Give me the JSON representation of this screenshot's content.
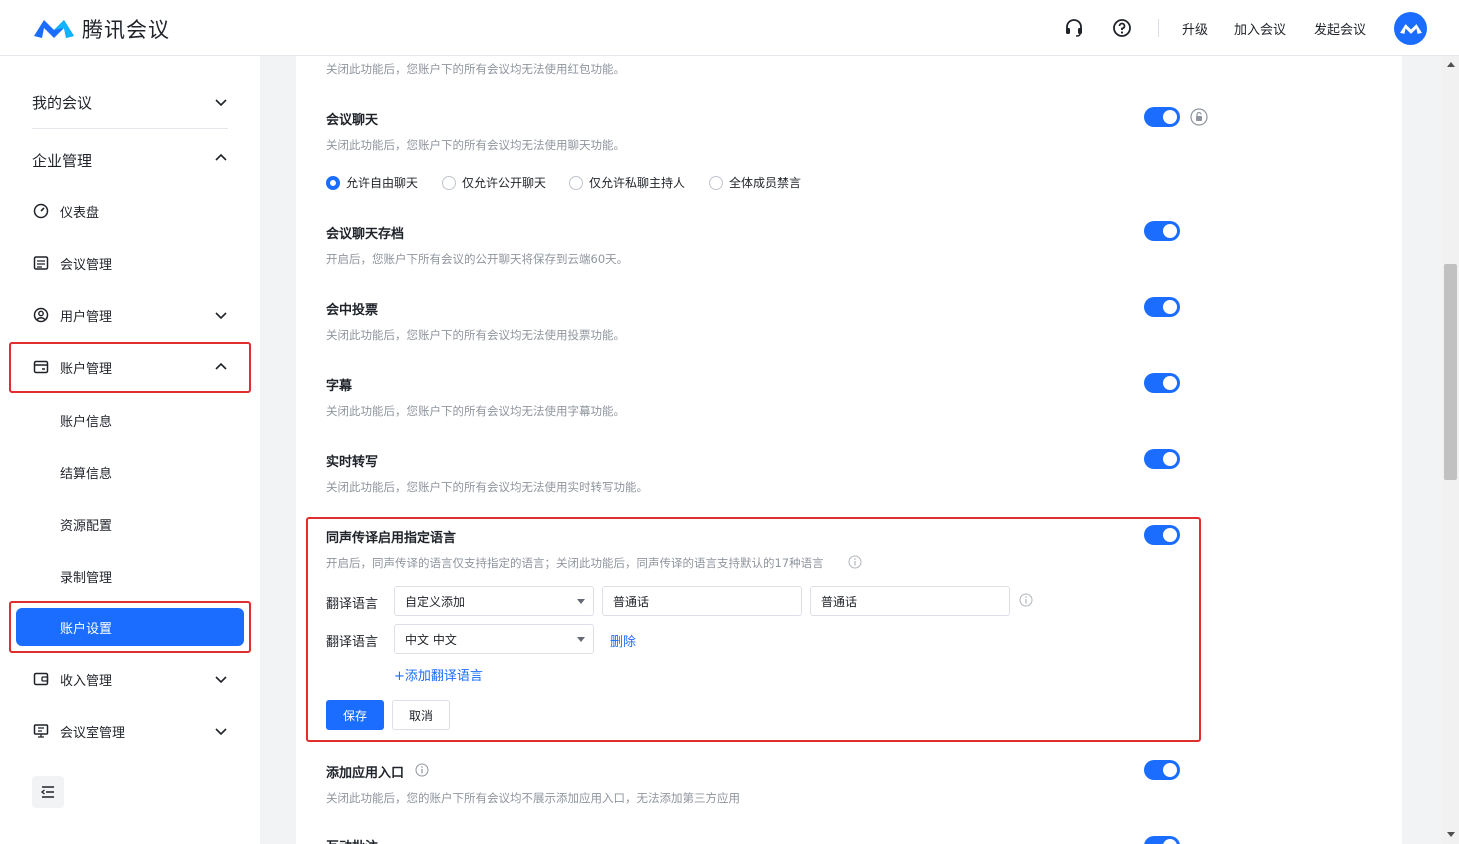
{
  "header": {
    "app_name": "腾讯会议",
    "links": {
      "upgrade": "升级",
      "join": "加入会议",
      "start": "发起会议"
    },
    "icons": [
      "headset-icon",
      "help-icon",
      "avatar-logo-icon"
    ]
  },
  "sidebar": {
    "my_meetings": "我的会议",
    "enterprise": "企业管理",
    "items": {
      "dashboard": "仪表盘",
      "meeting_mgmt": "会议管理",
      "user_mgmt": "用户管理",
      "account_mgmt": "账户管理",
      "income_mgmt": "收入管理",
      "room_mgmt": "会议室管理"
    },
    "account_sub": {
      "info": "账户信息",
      "billing": "结算信息",
      "resources": "资源配置",
      "recording": "录制管理",
      "settings": "账户设置"
    }
  },
  "settings": {
    "top_desc": "关闭此功能后，您账户下的所有会议均无法使用红包功能。",
    "chat": {
      "title": "会议聊天",
      "desc": "关闭此功能后，您账户下的所有会议均无法使用聊天功能。",
      "enabled": true
    },
    "chat_options": [
      "允许自由聊天",
      "仅允许公开聊天",
      "仅允许私聊主持人",
      "全体成员禁言"
    ],
    "chat_selected": "允许自由聊天",
    "chat_archive": {
      "title": "会议聊天存档",
      "desc": "开启后，您账户下所有会议的公开聊天将保存到云端60天。",
      "enabled": true
    },
    "vote": {
      "title": "会中投票",
      "desc": "关闭此功能后，您账户下的所有会议均无法使用投票功能。",
      "enabled": true
    },
    "subtitle": {
      "title": "字幕",
      "desc": "关闭此功能后，您账户下的所有会议均无法使用字幕功能。",
      "enabled": true
    },
    "transcribe": {
      "title": "实时转写",
      "desc": "关闭此功能后，您账户下的所有会议均无法使用实时转写功能。",
      "enabled": true
    },
    "interpretation": {
      "title": "同声传译启用指定语言",
      "desc": "开启后，同声传译的语言仅支持指定的语言；关闭此功能后，同声传译的语言支持默认的17种语言",
      "enabled": true,
      "row1": {
        "label": "翻译语言",
        "select": "自定义添加",
        "input1": "普通话",
        "input2": "普通话"
      },
      "row2": {
        "label": "翻译语言",
        "select": "中文 中文",
        "delete": "删除"
      },
      "add_link": "+添加翻译语言",
      "save": "保存",
      "cancel": "取消"
    },
    "app_entry": {
      "title": "添加应用入口",
      "desc": "关闭此功能后，您的账户下所有会议均不展示添加应用入口，无法添加第三方应用",
      "enabled": true
    },
    "next_partial": {
      "title": "互动批注",
      "enabled": true
    }
  },
  "colors": {
    "primary": "#1a6dff",
    "highlight": "#e02d2d",
    "muted": "#8f959e"
  }
}
